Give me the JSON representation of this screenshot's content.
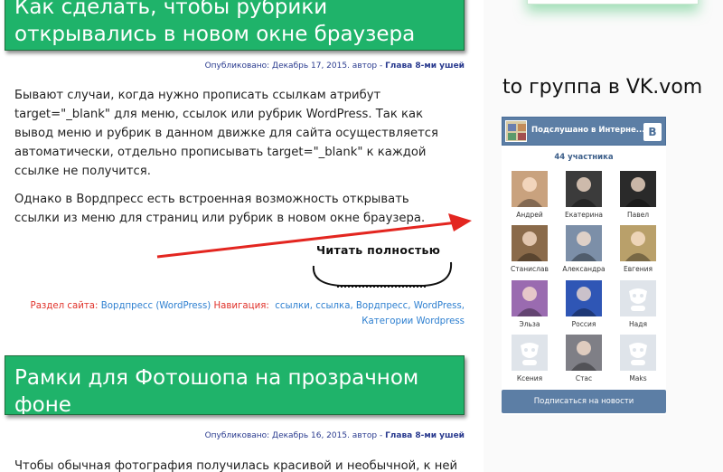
{
  "post1": {
    "title": "Как сделать, чтобы рубрики открывались в новом окне браузера",
    "meta_prefix": "Опубликовано: Декабрь 17, 2015. автор - ",
    "meta_author": "Глава 8-ми ушей",
    "paragraph1": "Бывают случаи, когда нужно прописать ссылкам атрибут target=\"_blank\" для меню, ссылок или рубрик WordPress. Так как вывод меню и рубрик в данном движке для сайта осуществляется автоматически, отдельно прописывать target=\"_blank\" к каждой ссылке не получится.",
    "paragraph2": "Однако в Вордпресс есть встроенная возможность открывать ссылки из меню для страниц или рубрик в новом окне браузера.",
    "read_more": "Читать полностью",
    "section_label": "Раздел сайта:",
    "section_link": "Вордпресс (WordPress)",
    "nav_label": "Навигация:",
    "tags": [
      "ссылки",
      "ссылка",
      "Вордпресс",
      "WordPress",
      "Категории Wordpress"
    ]
  },
  "post2": {
    "title": "Рамки для Фотошопа на прозрачном фоне",
    "meta_prefix": "Опубликовано: Декабрь 16, 2015. автор - ",
    "meta_author": "Глава 8-ми ушей",
    "paragraph1": "Чтобы обычная фотография получилась красивой и необычной, к ней"
  },
  "sidebar": {
    "group_heading": "to группа в VK.vom",
    "vk": {
      "group_name": "Подслушано в Интерне...",
      "logo": "В",
      "members_count": "44 участника",
      "members": [
        {
          "name": "Андрей",
          "photo": "photo-couple",
          "color": "#c9a27e"
        },
        {
          "name": "Екатерина",
          "photo": "photo-woman-dark",
          "color": "#3b3b3b"
        },
        {
          "name": "Павел",
          "photo": "photo-man-suit",
          "color": "#2a2a2a"
        },
        {
          "name": "Станислав",
          "photo": "photo-animal",
          "color": "#8a6a4a"
        },
        {
          "name": "Александра",
          "photo": "photo-woman-blonde",
          "color": "#7c8fa8"
        },
        {
          "name": "Евгения",
          "photo": "photo-woman-outdoor",
          "color": "#b9a06a"
        },
        {
          "name": "Эльза",
          "photo": "photo-flowers",
          "color": "#9a6bb0"
        },
        {
          "name": "Россия",
          "photo": "photo-flag-emblem",
          "color": "#2f56b5"
        },
        {
          "name": "Надя",
          "photo": "default-avatar",
          "color": "#dfe4ea"
        },
        {
          "name": "Ксения",
          "photo": "default-avatar",
          "color": "#dfe4ea"
        },
        {
          "name": "Стас",
          "photo": "photo-man-winter",
          "color": "#7f7f86"
        },
        {
          "name": "Maks",
          "photo": "default-avatar",
          "color": "#dfe4ea"
        }
      ],
      "subscribe_label": "Подписаться на новости",
      "accent_color": "#5c7ea5"
    }
  },
  "colors": {
    "title_bg": "#1fb36a",
    "link": "#2d7fd0",
    "label_red": "#e0322a",
    "arrow": "#e32620"
  }
}
